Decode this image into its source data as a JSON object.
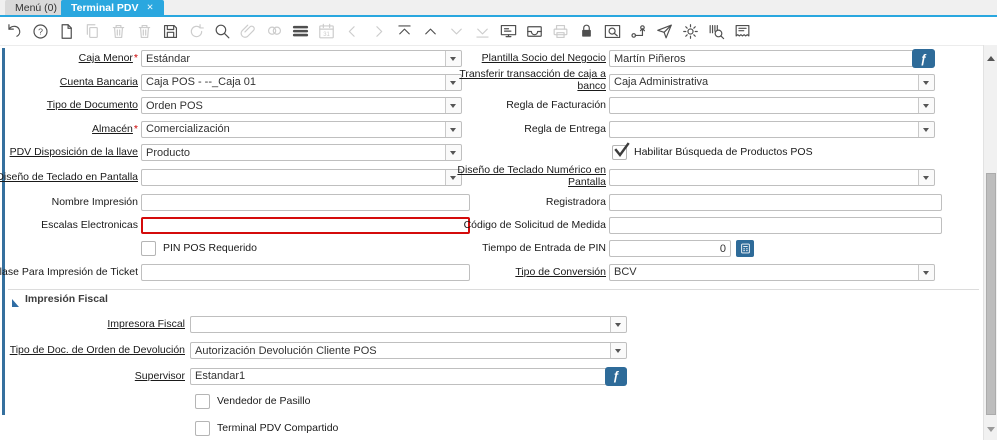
{
  "tab_bar": {
    "menu_tab": "Menú (0)",
    "active_tab": "Terminal PDV",
    "close_icon": "✕"
  },
  "toolbar_icons": [
    {
      "name": "undo",
      "enabled": true
    },
    {
      "name": "help",
      "enabled": true
    },
    {
      "name": "new-record",
      "enabled": true
    },
    {
      "name": "copy-record",
      "enabled": false
    },
    {
      "name": "delete-record",
      "enabled": false
    },
    {
      "name": "delete-selection",
      "enabled": false
    },
    {
      "name": "save",
      "enabled": true
    },
    {
      "name": "requery",
      "enabled": false
    },
    {
      "name": "find",
      "enabled": true
    },
    {
      "name": "attachment",
      "enabled": false
    },
    {
      "name": "chat",
      "enabled": false
    },
    {
      "name": "grid-toggle",
      "enabled": true
    },
    {
      "name": "history",
      "enabled": false
    },
    {
      "name": "parent-record",
      "enabled": false
    },
    {
      "name": "detail-record",
      "enabled": false
    },
    {
      "name": "first-record",
      "enabled": true
    },
    {
      "name": "previous-record",
      "enabled": true
    },
    {
      "name": "next-record",
      "enabled": false
    },
    {
      "name": "last-record",
      "enabled": false
    },
    {
      "name": "report",
      "enabled": true
    },
    {
      "name": "archive",
      "enabled": true
    },
    {
      "name": "print",
      "enabled": false
    },
    {
      "name": "private-record-lock",
      "enabled": true
    },
    {
      "name": "zoom-across",
      "enabled": true
    },
    {
      "name": "workflow",
      "enabled": true
    },
    {
      "name": "requests",
      "enabled": true
    },
    {
      "name": "process",
      "enabled": true
    },
    {
      "name": "product-info",
      "enabled": true
    },
    {
      "name": "pos-ticket",
      "enabled": true
    }
  ],
  "icons": {
    "editor_glyph": "ƒ"
  },
  "form": {
    "left": {
      "caja_menor": {
        "label": "Caja Menor",
        "required": "*",
        "value": "Estándar"
      },
      "cuenta_bancaria": {
        "label": "Cuenta Bancaria",
        "value": "Caja POS - --_Caja 01"
      },
      "tipo_documento": {
        "label": "Tipo de Documento",
        "value": "Orden POS"
      },
      "almacen": {
        "label": "Almacén",
        "required": "*",
        "value": "Comercialización"
      },
      "pdv_disposicion": {
        "label": "PDV Disposición de la llave",
        "value": "Producto"
      },
      "teclado_pantalla": {
        "label": "Diseño de Teclado en Pantalla",
        "value": ""
      },
      "nombre_impresion": {
        "label": "Nombre Impresión",
        "value": ""
      },
      "escalas": {
        "label": "Escalas Electronicas",
        "value": ""
      },
      "pin_requerido": {
        "label": "PIN POS Requerido",
        "checked": false
      },
      "clase_ticket": {
        "label": "Clase Para Impresión de Ticket",
        "value": ""
      }
    },
    "right": {
      "plantilla": {
        "label": "Plantilla Socio del Negocio",
        "value": "Martín Piñeros"
      },
      "transferir": {
        "label": "Transferir transacción de caja a banco",
        "value": "Caja Administrativa"
      },
      "regla_fact": {
        "label": "Regla de Facturación",
        "value": ""
      },
      "regla_entrega": {
        "label": "Regla de Entrega",
        "value": ""
      },
      "habilitar_busqueda": {
        "label": "Habilitar Búsqueda de Productos POS",
        "checked": true
      },
      "teclado_numerico": {
        "label": "Diseño de Teclado Numérico en Pantalla",
        "value": ""
      },
      "registradora": {
        "label": "Registradora",
        "value": ""
      },
      "codigo_medida": {
        "label": "Código de Solicitud de Medida",
        "value": ""
      },
      "tiempo_pin": {
        "label": "Tiempo de Entrada de PIN",
        "value": "0"
      },
      "tipo_conversion": {
        "label": "Tipo de Conversión",
        "value": "BCV"
      }
    },
    "fiscal": {
      "title": "Impresión Fiscal",
      "impresora": {
        "label": "Impresora Fiscal",
        "value": ""
      },
      "tipo_doc_devolucion": {
        "label": "Tipo de Doc. de Orden de Devolución",
        "value": "Autorización Devolución Cliente POS"
      },
      "supervisor": {
        "label": "Supervisor",
        "value": "Estandar1"
      },
      "vendedor_pasillo": {
        "label": "Vendedor de Pasillo",
        "checked": false
      },
      "terminal_compartido": {
        "label": "Terminal PDV Compartido",
        "checked": false
      }
    }
  },
  "colors": {
    "accent_cyan": "#29a7df",
    "button_blue": "#2e6b99",
    "left_bar_blue": "#35709e",
    "error_red": "#d40b0b"
  }
}
